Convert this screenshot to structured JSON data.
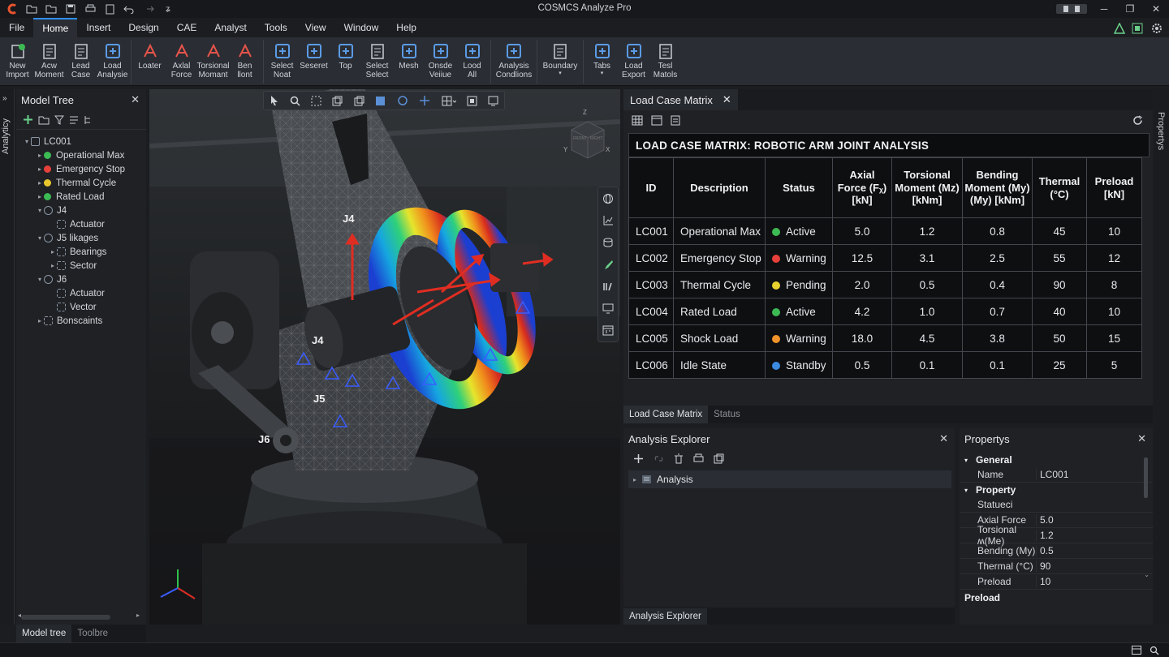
{
  "app": {
    "title": "COSMCS Analyze Pro"
  },
  "menu": [
    "File",
    "Home",
    "Insert",
    "Design",
    "CAE",
    "Analyst",
    "Tools",
    "View",
    "Window",
    "Help"
  ],
  "ribbon": [
    {
      "label": "New\nImport",
      "icon": "new-import-icon"
    },
    {
      "label": "Acw\nMoment",
      "icon": "moment-icon"
    },
    {
      "label": "Lead\nCase",
      "icon": "load-case-icon"
    },
    {
      "label": "Load\nAnalysie",
      "icon": "load-analysis-icon"
    },
    {
      "label": "Loater",
      "icon": "loater-icon"
    },
    {
      "label": "Axlal\nForce",
      "icon": "axial-force-icon"
    },
    {
      "label": "Torsional\nMomant",
      "icon": "torsional-moment-icon"
    },
    {
      "label": "Ben\nllont",
      "icon": "bending-moment-icon"
    },
    {
      "label": "Select\nNoat",
      "icon": "select-node-icon"
    },
    {
      "label": "Seseret",
      "icon": "seseret-icon"
    },
    {
      "label": "Top",
      "icon": "top-icon"
    },
    {
      "label": "Select\nSelect",
      "icon": "select-select-icon"
    },
    {
      "label": "Mesh",
      "icon": "mesh-icon"
    },
    {
      "label": "Onsde\nVeiiue",
      "icon": "onsde-value-icon"
    },
    {
      "label": "Lood\nAll",
      "icon": "load-all-icon"
    },
    {
      "label": "Analysis\nCondlions",
      "icon": "analysis-conditions-icon"
    },
    {
      "label": "Boundary",
      "icon": "boundary-icon"
    },
    {
      "label": "Tabs",
      "icon": "tabs-icon"
    },
    {
      "label": "Load\nExport",
      "icon": "load-export-icon"
    },
    {
      "label": "Tesl\nMatols",
      "icon": "test-materials-icon"
    }
  ],
  "side_tab_left": "Analyticy",
  "side_tab_right": "Propertys",
  "model_tree": {
    "title": "Model Tree",
    "rows": [
      {
        "text": "LC001",
        "level": 0,
        "caret": "▾",
        "kind": "case"
      },
      {
        "text": "Operational Max",
        "level": 1,
        "caret": "▸",
        "kind": "dot",
        "color": "#3cba54"
      },
      {
        "text": "Emergency Stop",
        "level": 1,
        "caret": "▸",
        "kind": "dot",
        "color": "#e5403a"
      },
      {
        "text": "Thermal Cycle",
        "level": 1,
        "caret": "▸",
        "kind": "dot",
        "color": "#e8c72e"
      },
      {
        "text": "Rated Load",
        "level": 1,
        "caret": "▸",
        "kind": "dot",
        "color": "#3cba54"
      },
      {
        "text": "J4",
        "level": 1,
        "caret": "▾",
        "kind": "joint"
      },
      {
        "text": "Actuator",
        "level": 2,
        "caret": "",
        "kind": "part"
      },
      {
        "text": "J5 likages",
        "level": 1,
        "caret": "▾",
        "kind": "joint"
      },
      {
        "text": "Bearings",
        "level": 2,
        "caret": "▸",
        "kind": "part"
      },
      {
        "text": "Sector",
        "level": 2,
        "caret": "▸",
        "kind": "part"
      },
      {
        "text": "J6",
        "level": 1,
        "caret": "▾",
        "kind": "joint"
      },
      {
        "text": "Actuator",
        "level": 2,
        "caret": "",
        "kind": "part"
      },
      {
        "text": "Vector",
        "level": 2,
        "caret": "",
        "kind": "part"
      },
      {
        "text": "Bonscaints",
        "level": 1,
        "caret": "▸",
        "kind": "part"
      }
    ],
    "bottom_tabs": [
      "Model tree",
      "Toolbre"
    ]
  },
  "viewport": {
    "joint_labels": [
      "J4",
      "J4",
      "J5",
      "J6"
    ],
    "viewcube": {
      "axis_z": "Z",
      "axis_x": "X",
      "axis_y": "Y",
      "face_front": "FRONT",
      "face_right": "RIGHT"
    }
  },
  "matrix": {
    "tab": "Load Case Matrix",
    "title": "LOAD CASE MATRIX: ROBOTIC ARM JOINT ANALYSIS",
    "headers": [
      "ID",
      "Description",
      "Status",
      "Axial Force (Fᵪ) [kN]",
      "Torsional Moment (Mᴢ) [kNm]",
      "Bending Moment (My) (My) [kNm]",
      "Thermal (°C)",
      "Preload [kN]"
    ],
    "rows": [
      {
        "id": "LC001",
        "desc": "Operational Max",
        "status": "Active",
        "color": "#3cba54",
        "axial": "5.0",
        "tors": "1.2",
        "bend": "0.8",
        "therm": "45",
        "pre": "10"
      },
      {
        "id": "LC002",
        "desc": "Emergency Stop",
        "status": "Warning",
        "color": "#e5403a",
        "axial": "12.5",
        "tors": "3.1",
        "bend": "2.5",
        "therm": "55",
        "pre": "12"
      },
      {
        "id": "LC003",
        "desc": "Thermal Cycle",
        "status": "Pending",
        "color": "#e8d12e",
        "axial": "2.0",
        "tors": "0.5",
        "bend": "0.4",
        "therm": "90",
        "pre": "8"
      },
      {
        "id": "LC004",
        "desc": "Rated Load",
        "status": "Active",
        "color": "#3cba54",
        "axial": "4.2",
        "tors": "1.0",
        "bend": "0.7",
        "therm": "40",
        "pre": "10"
      },
      {
        "id": "LC005",
        "desc": "Shock Load",
        "status": "Warning",
        "color": "#f0932b",
        "axial": "18.0",
        "tors": "4.5",
        "bend": "3.8",
        "therm": "50",
        "pre": "15"
      },
      {
        "id": "LC006",
        "desc": "Idle State",
        "status": "Standby",
        "color": "#3b8be0",
        "axial": "0.5",
        "tors": "0.1",
        "bend": "0.1",
        "therm": "25",
        "pre": "5"
      }
    ],
    "bottom_tabs": [
      "Load Case Matrix",
      "Status"
    ]
  },
  "analysis_explorer": {
    "title": "Analysis Explorer",
    "item": "Analysis",
    "bottom_tab": "Analysis Explorer"
  },
  "properties": {
    "title": "Propertys",
    "group_general": "General",
    "name_key": "Name",
    "name_val": "LC001",
    "group_property": "Property",
    "rows": [
      {
        "k": "Statueci",
        "v": ""
      },
      {
        "k": "Axial Force",
        "v": "5.0"
      },
      {
        "k": "Torsional ʍ(Me)",
        "v": "1.2"
      },
      {
        "k": "Bending (My)",
        "v": "0.5"
      },
      {
        "k": "Thermal (°C)",
        "v": "90"
      },
      {
        "k": "Preload",
        "v": "10"
      }
    ],
    "footer": "Preload"
  }
}
